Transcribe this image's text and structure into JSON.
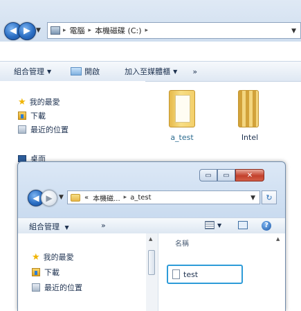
{
  "back_window": {
    "address": {
      "segments": [
        "電腦",
        "本機磁碟 (C:)"
      ]
    },
    "toolbar": {
      "organize": "組合管理",
      "open": "開啟",
      "add_to_library": "加入至媒體櫃",
      "more": "»"
    },
    "nav": {
      "favorites": "我的最愛",
      "downloads": "下載",
      "recent": "最近的位置",
      "desktop": "桌面"
    },
    "items": [
      {
        "name": "a_test"
      },
      {
        "name": "Intel"
      }
    ]
  },
  "front_window": {
    "caption": {
      "minimize": "▭",
      "maximize": "▭",
      "close": "✕"
    },
    "address": {
      "prefix": "«",
      "segments": [
        "本機磁...",
        "a_test"
      ]
    },
    "refresh": "↻",
    "toolbar": {
      "organize": "組合管理",
      "more": "»"
    },
    "nav": {
      "favorites": "我的最愛",
      "downloads": "下載",
      "recent": "最近的位置"
    },
    "column_header": "名稱",
    "files": [
      {
        "name": "test"
      }
    ]
  },
  "colors": {
    "accent": "#2b6fc4",
    "selection": "#2d9bd8",
    "close": "#c3402c"
  }
}
